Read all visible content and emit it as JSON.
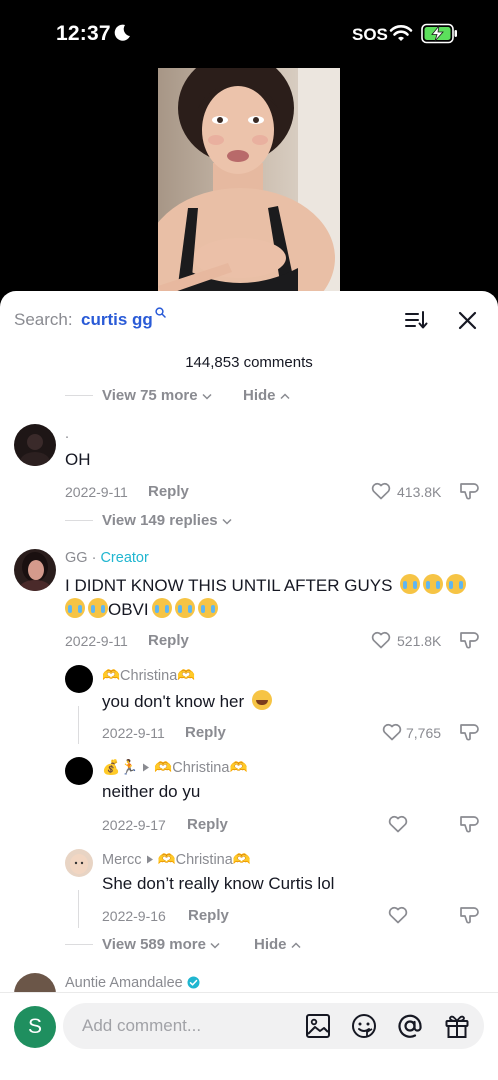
{
  "status": {
    "time": "12:37",
    "sos": "SOS"
  },
  "header": {
    "search_label": "Search:",
    "search_term": "curtis gg"
  },
  "comment_count": "144,853 comments",
  "top_controls": {
    "view_more": "View 75 more",
    "hide": "Hide"
  },
  "comments": [
    {
      "username": ".",
      "text": "OH",
      "date": "2022-9-11",
      "reply": "Reply",
      "likes": "413.8K",
      "view_replies": "View 149 replies"
    },
    {
      "username": "GG",
      "separator": " · ",
      "badge": "Creator",
      "text_line1": "I DIDNT KNOW THIS UNTIL AFTER GUYS",
      "text_line2": "OBVI",
      "date": "2022-9-11",
      "reply": "Reply",
      "likes": "521.8K",
      "replies": [
        {
          "username": "🫶Christina🫶",
          "text": "you don't know her",
          "date": "2022-9-11",
          "reply": "Reply",
          "likes": "7,765"
        },
        {
          "username": "💰🏃",
          "reply_to": "🫶Christina🫶",
          "text": "neither do yu",
          "date": "2022-9-17",
          "reply": "Reply"
        },
        {
          "username": "Mercc",
          "reply_to": "🫶Christina🫶",
          "text": "She don’t really know Curtis lol",
          "date": "2022-9-16",
          "reply": "Reply"
        }
      ],
      "view_more": "View 589 more",
      "hide": "Hide"
    },
    {
      "username": "Auntie Amandalee"
    }
  ],
  "bottom": {
    "avatar_letter": "S",
    "placeholder": "Add comment..."
  },
  "colors": {
    "link_blue": "#2a5bd7",
    "creator_teal": "#20b6d0",
    "avatar_green": "#1f8f5f",
    "muted": "#8a8b91"
  }
}
